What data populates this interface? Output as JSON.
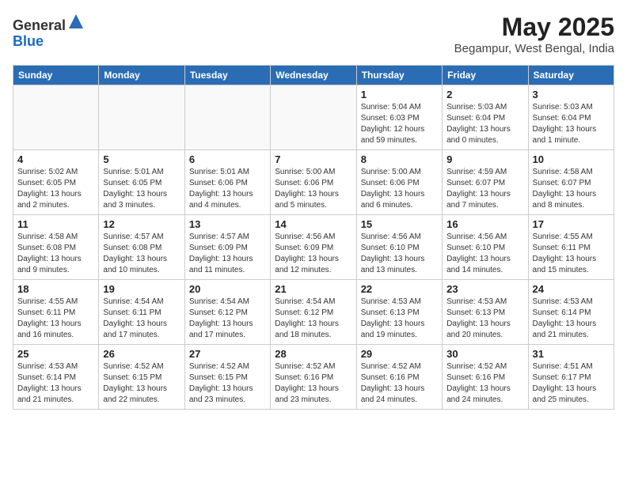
{
  "header": {
    "logo_general": "General",
    "logo_blue": "Blue",
    "month_title": "May 2025",
    "location": "Begampur, West Bengal, India"
  },
  "weekdays": [
    "Sunday",
    "Monday",
    "Tuesday",
    "Wednesday",
    "Thursday",
    "Friday",
    "Saturday"
  ],
  "weeks": [
    [
      {
        "day": "",
        "info": ""
      },
      {
        "day": "",
        "info": ""
      },
      {
        "day": "",
        "info": ""
      },
      {
        "day": "",
        "info": ""
      },
      {
        "day": "1",
        "info": "Sunrise: 5:04 AM\nSunset: 6:03 PM\nDaylight: 12 hours\nand 59 minutes."
      },
      {
        "day": "2",
        "info": "Sunrise: 5:03 AM\nSunset: 6:04 PM\nDaylight: 13 hours\nand 0 minutes."
      },
      {
        "day": "3",
        "info": "Sunrise: 5:03 AM\nSunset: 6:04 PM\nDaylight: 13 hours\nand 1 minute."
      }
    ],
    [
      {
        "day": "4",
        "info": "Sunrise: 5:02 AM\nSunset: 6:05 PM\nDaylight: 13 hours\nand 2 minutes."
      },
      {
        "day": "5",
        "info": "Sunrise: 5:01 AM\nSunset: 6:05 PM\nDaylight: 13 hours\nand 3 minutes."
      },
      {
        "day": "6",
        "info": "Sunrise: 5:01 AM\nSunset: 6:06 PM\nDaylight: 13 hours\nand 4 minutes."
      },
      {
        "day": "7",
        "info": "Sunrise: 5:00 AM\nSunset: 6:06 PM\nDaylight: 13 hours\nand 5 minutes."
      },
      {
        "day": "8",
        "info": "Sunrise: 5:00 AM\nSunset: 6:06 PM\nDaylight: 13 hours\nand 6 minutes."
      },
      {
        "day": "9",
        "info": "Sunrise: 4:59 AM\nSunset: 6:07 PM\nDaylight: 13 hours\nand 7 minutes."
      },
      {
        "day": "10",
        "info": "Sunrise: 4:58 AM\nSunset: 6:07 PM\nDaylight: 13 hours\nand 8 minutes."
      }
    ],
    [
      {
        "day": "11",
        "info": "Sunrise: 4:58 AM\nSunset: 6:08 PM\nDaylight: 13 hours\nand 9 minutes."
      },
      {
        "day": "12",
        "info": "Sunrise: 4:57 AM\nSunset: 6:08 PM\nDaylight: 13 hours\nand 10 minutes."
      },
      {
        "day": "13",
        "info": "Sunrise: 4:57 AM\nSunset: 6:09 PM\nDaylight: 13 hours\nand 11 minutes."
      },
      {
        "day": "14",
        "info": "Sunrise: 4:56 AM\nSunset: 6:09 PM\nDaylight: 13 hours\nand 12 minutes."
      },
      {
        "day": "15",
        "info": "Sunrise: 4:56 AM\nSunset: 6:10 PM\nDaylight: 13 hours\nand 13 minutes."
      },
      {
        "day": "16",
        "info": "Sunrise: 4:56 AM\nSunset: 6:10 PM\nDaylight: 13 hours\nand 14 minutes."
      },
      {
        "day": "17",
        "info": "Sunrise: 4:55 AM\nSunset: 6:11 PM\nDaylight: 13 hours\nand 15 minutes."
      }
    ],
    [
      {
        "day": "18",
        "info": "Sunrise: 4:55 AM\nSunset: 6:11 PM\nDaylight: 13 hours\nand 16 minutes."
      },
      {
        "day": "19",
        "info": "Sunrise: 4:54 AM\nSunset: 6:11 PM\nDaylight: 13 hours\nand 17 minutes."
      },
      {
        "day": "20",
        "info": "Sunrise: 4:54 AM\nSunset: 6:12 PM\nDaylight: 13 hours\nand 17 minutes."
      },
      {
        "day": "21",
        "info": "Sunrise: 4:54 AM\nSunset: 6:12 PM\nDaylight: 13 hours\nand 18 minutes."
      },
      {
        "day": "22",
        "info": "Sunrise: 4:53 AM\nSunset: 6:13 PM\nDaylight: 13 hours\nand 19 minutes."
      },
      {
        "day": "23",
        "info": "Sunrise: 4:53 AM\nSunset: 6:13 PM\nDaylight: 13 hours\nand 20 minutes."
      },
      {
        "day": "24",
        "info": "Sunrise: 4:53 AM\nSunset: 6:14 PM\nDaylight: 13 hours\nand 21 minutes."
      }
    ],
    [
      {
        "day": "25",
        "info": "Sunrise: 4:53 AM\nSunset: 6:14 PM\nDaylight: 13 hours\nand 21 minutes."
      },
      {
        "day": "26",
        "info": "Sunrise: 4:52 AM\nSunset: 6:15 PM\nDaylight: 13 hours\nand 22 minutes."
      },
      {
        "day": "27",
        "info": "Sunrise: 4:52 AM\nSunset: 6:15 PM\nDaylight: 13 hours\nand 23 minutes."
      },
      {
        "day": "28",
        "info": "Sunrise: 4:52 AM\nSunset: 6:16 PM\nDaylight: 13 hours\nand 23 minutes."
      },
      {
        "day": "29",
        "info": "Sunrise: 4:52 AM\nSunset: 6:16 PM\nDaylight: 13 hours\nand 24 minutes."
      },
      {
        "day": "30",
        "info": "Sunrise: 4:52 AM\nSunset: 6:16 PM\nDaylight: 13 hours\nand 24 minutes."
      },
      {
        "day": "31",
        "info": "Sunrise: 4:51 AM\nSunset: 6:17 PM\nDaylight: 13 hours\nand 25 minutes."
      }
    ]
  ]
}
